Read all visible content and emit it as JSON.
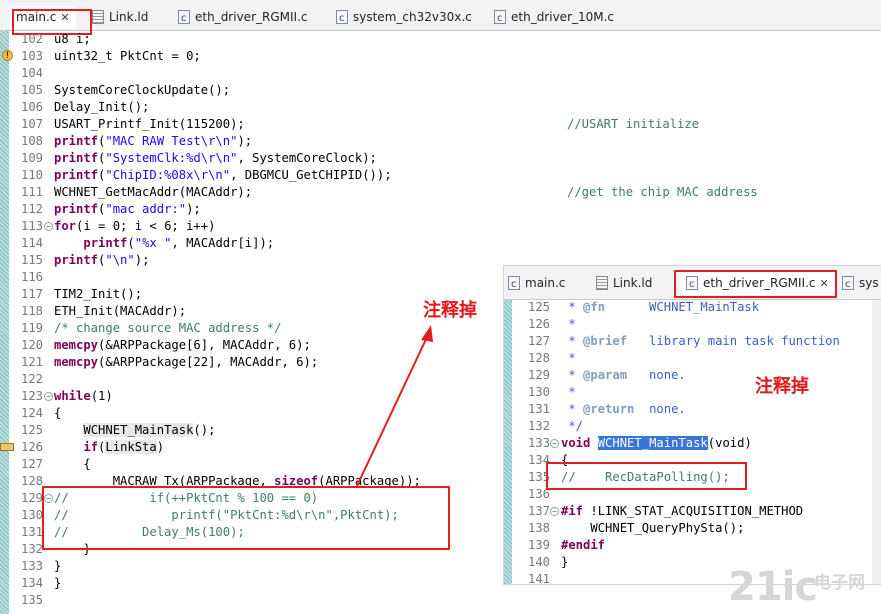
{
  "main_tabs": [
    {
      "label": "main.c",
      "icon": "c-file-icon",
      "active": true
    },
    {
      "label": "Link.ld",
      "icon": "linker-file-icon",
      "active": false
    },
    {
      "label": "eth_driver_RGMII.c",
      "icon": "c-file-icon",
      "active": false
    },
    {
      "label": "system_ch32v30x.c",
      "icon": "c-file-icon",
      "active": false
    },
    {
      "label": "eth_driver_10M.c",
      "icon": "c-file-icon",
      "active": false
    }
  ],
  "main_lines": [
    {
      "n": "102",
      "code": "u8 i;"
    },
    {
      "n": "103",
      "code": "uint32_t PktCnt = 0;"
    },
    {
      "n": "104",
      "code": ""
    },
    {
      "n": "105",
      "code": "SystemCoreClockUpdate();"
    },
    {
      "n": "106",
      "code": "Delay_Init();"
    },
    {
      "n": "107",
      "code": "USART_Printf_Init(115200);",
      "comment": "//USART initialize"
    },
    {
      "n": "108",
      "code": "printf(\"MAC RAW Test\\r\\n\");"
    },
    {
      "n": "109",
      "code": "printf(\"SystemClk:%d\\r\\n\", SystemCoreClock);"
    },
    {
      "n": "110",
      "code": "printf(\"ChipID:%08x\\r\\n\", DBGMCU_GetCHIPID());"
    },
    {
      "n": "111",
      "code": "WCHNET_GetMacAddr(MACAddr);",
      "comment": "//get the chip MAC address"
    },
    {
      "n": "112",
      "code": "printf(\"mac addr:\");"
    },
    {
      "n": "113",
      "code": "for(i = 0; i < 6; i++)"
    },
    {
      "n": "114",
      "code": "    printf(\"%x \", MACAddr[i]);"
    },
    {
      "n": "115",
      "code": "printf(\"\\n\");"
    },
    {
      "n": "116",
      "code": ""
    },
    {
      "n": "117",
      "code": "TIM2_Init();"
    },
    {
      "n": "118",
      "code": "ETH_Init(MACAddr);"
    },
    {
      "n": "119",
      "code": "/* change source MAC address */"
    },
    {
      "n": "120",
      "code": "memcpy(&ARPPackage[6], MACAddr, 6);"
    },
    {
      "n": "121",
      "code": "memcpy(&ARPPackage[22], MACAddr, 6);"
    },
    {
      "n": "122",
      "code": ""
    },
    {
      "n": "123",
      "code": "while(1)"
    },
    {
      "n": "124",
      "code": "{"
    },
    {
      "n": "125",
      "code": "    WCHNET_MainTask();"
    },
    {
      "n": "126",
      "code": "    if(LinkSta)"
    },
    {
      "n": "127",
      "code": "    {"
    },
    {
      "n": "128",
      "code": "        MACRAW_Tx(ARPPackage, sizeof(ARPPackage));"
    },
    {
      "n": "129",
      "code": "//          if(++PktCnt % 100 == 0)"
    },
    {
      "n": "130",
      "code": "//              printf(\"PktCnt:%d\\r\\n\",PktCnt);"
    },
    {
      "n": "131",
      "code": "//          Delay_Ms(100);"
    },
    {
      "n": "132",
      "code": "    }"
    },
    {
      "n": "133",
      "code": "}"
    },
    {
      "n": "134",
      "code": "}"
    },
    {
      "n": "135",
      "code": ""
    }
  ],
  "popup_tabs": [
    {
      "label": "main.c",
      "icon": "c-file-icon"
    },
    {
      "label": "Link.ld",
      "icon": "linker-file-icon"
    },
    {
      "label": "eth_driver_RGMII.c",
      "icon": "c-file-icon",
      "active": true
    },
    {
      "label": "sys",
      "icon": "c-file-icon"
    }
  ],
  "popup_lines": [
    {
      "n": "125",
      "code": " * @fn      WCHNET_MainTask"
    },
    {
      "n": "126",
      "code": " *"
    },
    {
      "n": "127",
      "code": " * @brief   library main task function"
    },
    {
      "n": "128",
      "code": " *"
    },
    {
      "n": "129",
      "code": " * @param   none."
    },
    {
      "n": "130",
      "code": " *"
    },
    {
      "n": "131",
      "code": " * @return  none."
    },
    {
      "n": "132",
      "code": " */"
    },
    {
      "n": "133",
      "code": "void WCHNET_MainTask(void)"
    },
    {
      "n": "134",
      "code": "{"
    },
    {
      "n": "135",
      "code": "//    RecDataPolling();"
    },
    {
      "n": "136",
      "code": ""
    },
    {
      "n": "137",
      "code": "#if !LINK_STAT_ACQUISITION_METHOD"
    },
    {
      "n": "138",
      "code": "    WCHNET_QueryPhySta();"
    },
    {
      "n": "139",
      "code": "#endif"
    },
    {
      "n": "140",
      "code": "}"
    },
    {
      "n": "141",
      "code": ""
    }
  ],
  "annotations": {
    "note_main": "注释掉",
    "note_popup": "注释掉",
    "annotation_color": "#e02020"
  },
  "watermark": {
    "big": "21ic",
    "cn": "电子网"
  },
  "colors": {
    "keyword": "#7f0055",
    "string": "#2a00ff",
    "comment": "#3f7f5f",
    "javadoc": "#3f5fbf",
    "selection": "#3875d7"
  }
}
